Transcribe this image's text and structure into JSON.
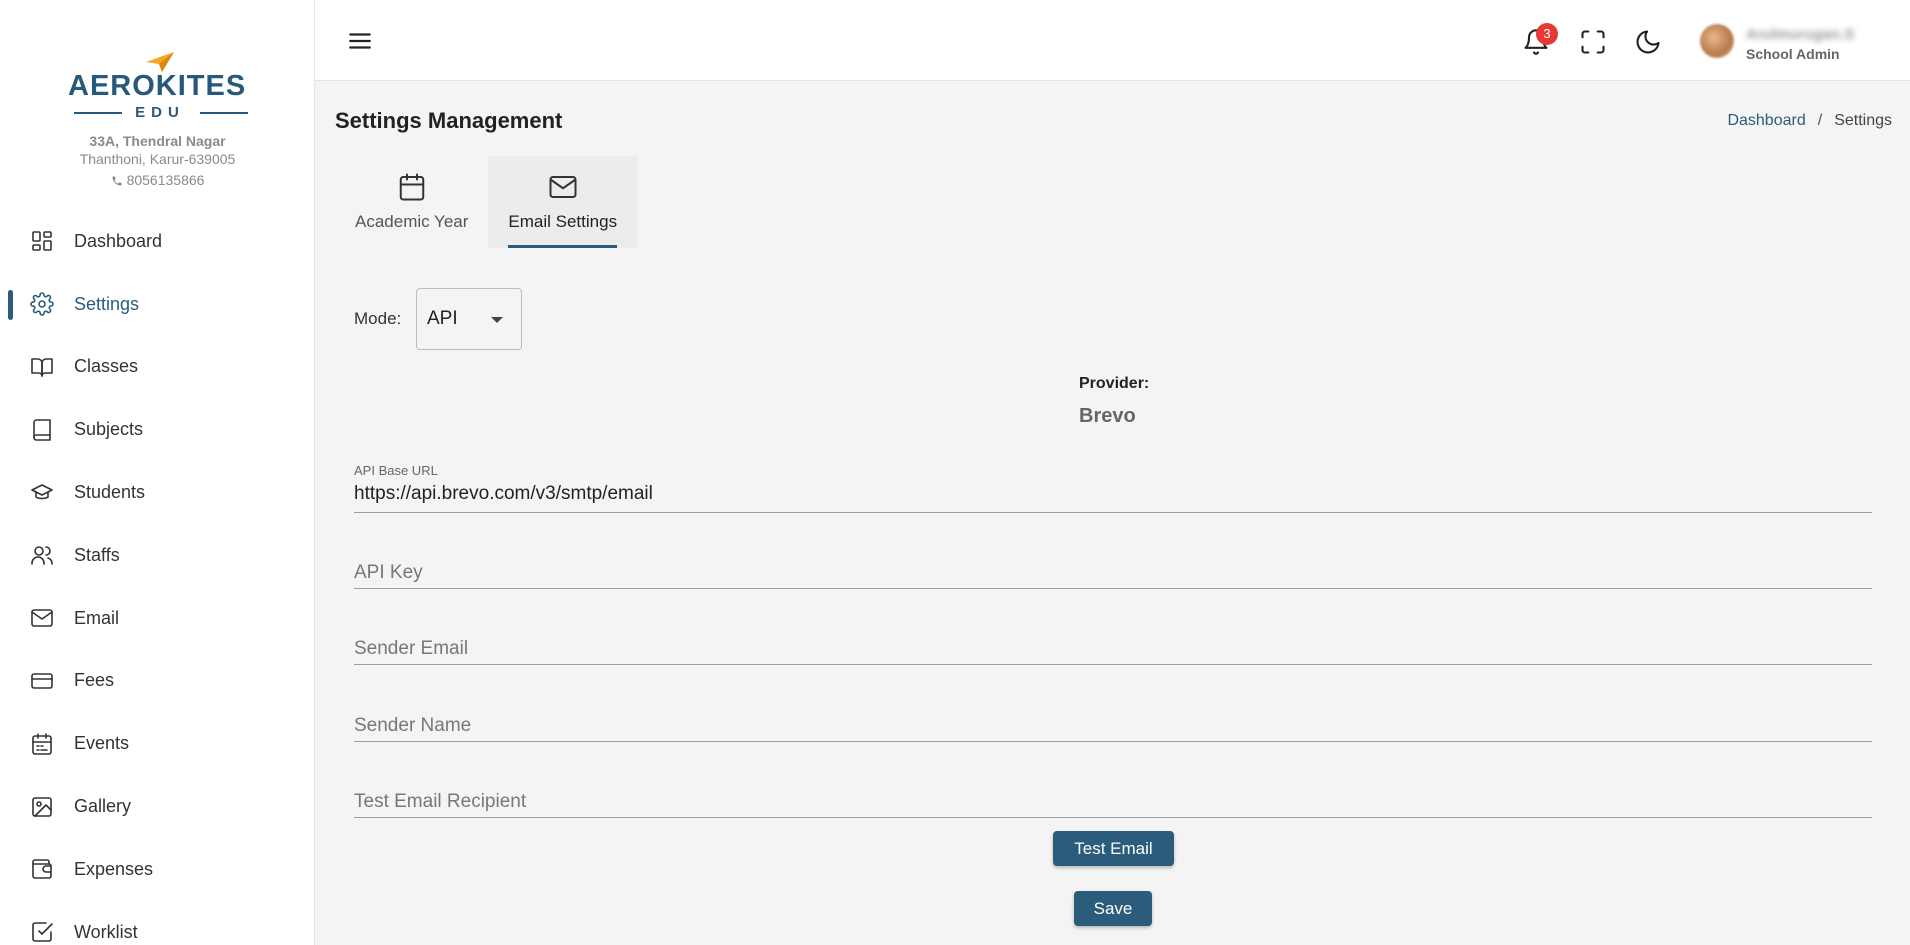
{
  "brand": {
    "name": "AEROKITES",
    "sub": "EDU",
    "address_line1": "33A, Thendral Nagar",
    "address_line2": "Thanthoni,  Karur-639005",
    "phone": "8056135866",
    "colors": {
      "primary": "#2b5c7c",
      "accent": "#f5a623"
    }
  },
  "sidebar": {
    "items": [
      {
        "label": "Dashboard",
        "icon": "dashboard-icon"
      },
      {
        "label": "Settings",
        "icon": "gear-icon",
        "active": true
      },
      {
        "label": "Classes",
        "icon": "open-book-icon"
      },
      {
        "label": "Subjects",
        "icon": "book-icon"
      },
      {
        "label": "Students",
        "icon": "graduation-cap-icon"
      },
      {
        "label": "Staffs",
        "icon": "users-icon"
      },
      {
        "label": "Email",
        "icon": "mail-icon"
      },
      {
        "label": "Fees",
        "icon": "credit-card-icon"
      },
      {
        "label": "Events",
        "icon": "calendar-icon"
      },
      {
        "label": "Gallery",
        "icon": "image-icon"
      },
      {
        "label": "Expenses",
        "icon": "wallet-icon"
      },
      {
        "label": "Worklist",
        "icon": "checkbox-icon"
      }
    ]
  },
  "topbar": {
    "notification_count": "3",
    "user_name": "Arulmurugan.S",
    "user_role": "School Admin"
  },
  "page": {
    "title": "Settings Management",
    "breadcrumb": {
      "home": "Dashboard",
      "separator": "/",
      "current": "Settings"
    }
  },
  "tabs": [
    {
      "label": "Academic Year",
      "icon": "calendar-icon"
    },
    {
      "label": "Email Settings",
      "icon": "mail-icon",
      "active": true
    }
  ],
  "form": {
    "mode_label": "Mode:",
    "mode_value": "API",
    "provider_label": "Provider:",
    "provider_value": "Brevo",
    "api_base_url_label": "API Base URL",
    "api_base_url_value": "https://api.brevo.com/v3/smtp/email",
    "api_key_placeholder": "API Key",
    "sender_email_placeholder": "Sender Email",
    "sender_name_placeholder": "Sender Name",
    "test_recipient_placeholder": "Test Email Recipient",
    "test_button": "Test Email",
    "save_button": "Save"
  }
}
